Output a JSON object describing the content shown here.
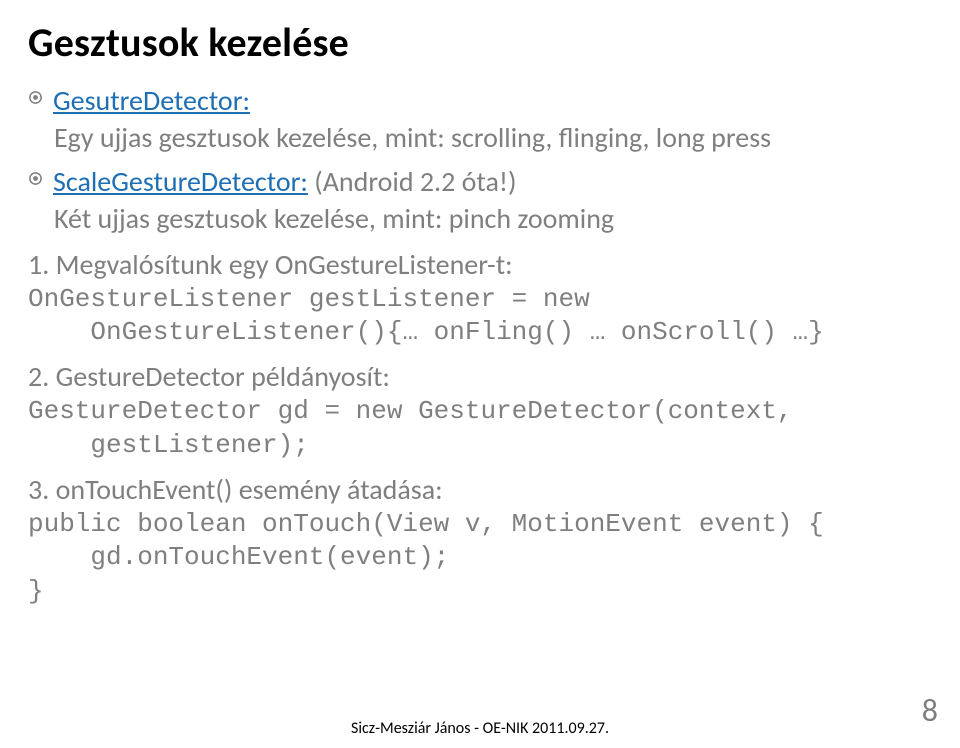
{
  "title": "Gesztusok kezelése",
  "bullets": [
    {
      "heading": "GesutreDetector:",
      "heading_href": "http://developer.android.com/reference/android/view/GestureDetector.html",
      "body": "Egy ujjas gesztusok kezelése, mint: scrolling, flinging, long press"
    },
    {
      "heading": "ScaleGestureDetector:",
      "heading_href": "http://developer.android.com/reference/android/view/ScaleGestureDetector.html",
      "note": " (Android 2.2 óta!)",
      "body": "Két ujjas gesztusok kezelése, mint: pinch zooming"
    }
  ],
  "steps": [
    {
      "num": "1.",
      "text": "Megvalósítunk egy OnGestureListener-t:",
      "code": [
        "OnGestureListener gestListener = new",
        "    OnGestureListener(){… onFling() … onScroll() …}"
      ]
    },
    {
      "num": "2.",
      "text": "GestureDetector példányosít:",
      "code": [
        "GestureDetector gd = new GestureDetector(context,",
        "    gestListener);"
      ]
    },
    {
      "num": "3.",
      "text": "onTouchEvent() esemény átadása:",
      "code": [
        "public boolean onTouch(View v, MotionEvent event) {",
        "    gd.onTouchEvent(event);",
        "}"
      ]
    }
  ],
  "footer": "Sicz-Mesziár János - OE-NIK      2011.09.27.",
  "page_number": "8"
}
